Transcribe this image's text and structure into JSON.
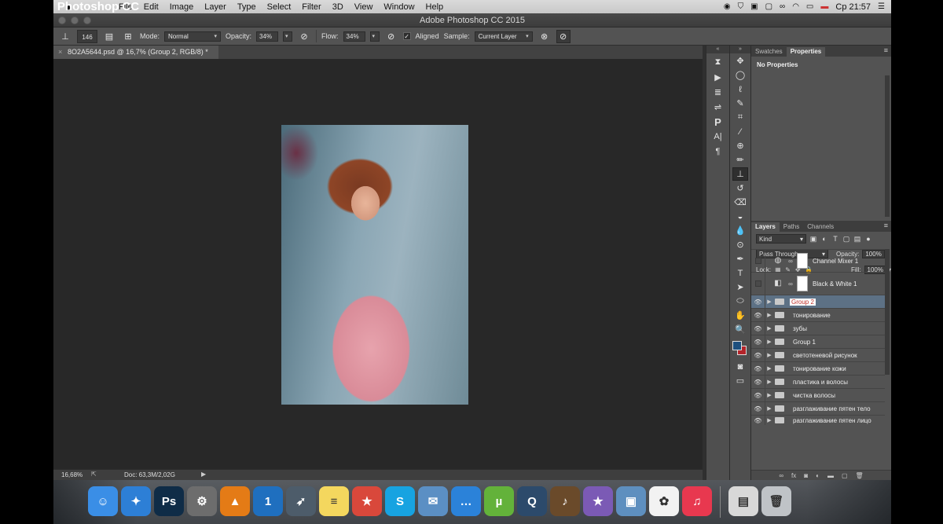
{
  "menubar": {
    "apple": "",
    "items": [
      "Photoshop CC",
      "File",
      "Edit",
      "Image",
      "Layer",
      "Type",
      "Select",
      "Filter",
      "3D",
      "View",
      "Window",
      "Help"
    ],
    "flag": "▬",
    "time": "Ср 21:57"
  },
  "window": {
    "title": "Adobe Photoshop CC 2015"
  },
  "options": {
    "brush_size": "146",
    "mode_label": "Mode:",
    "mode_value": "Normal",
    "opacity_label": "Opacity:",
    "opacity_value": "34%",
    "flow_label": "Flow:",
    "flow_value": "34%",
    "aligned_label": "Aligned",
    "aligned_checked": "✓",
    "sample_label": "Sample:",
    "sample_value": "Current Layer"
  },
  "document": {
    "tab_title": "8O2A5644.psd @ 16,7% (Group 2, RGB/8) *",
    "close": "×",
    "zoom": "16,68%",
    "doc_info": "Doc: 63,3M/2,02G"
  },
  "properties": {
    "tabs": [
      "Swatches",
      "Properties"
    ],
    "active_tab": "Properties",
    "content": "No Properties"
  },
  "layers": {
    "tabs": [
      "Layers",
      "Paths",
      "Channels"
    ],
    "kind_label": "Kind",
    "blend_mode": "Pass Through",
    "opacity_label": "Opacity:",
    "opacity_value": "100%",
    "lock_label": "Lock:",
    "fill_label": "Fill:",
    "fill_value": "100%",
    "items": [
      {
        "name": "Channel Mixer 1",
        "type": "adjustment",
        "visible": false
      },
      {
        "name": "Black & White 1",
        "type": "adjustment",
        "visible": false
      },
      {
        "name": "Group 2",
        "type": "group",
        "visible": true,
        "selected": true
      },
      {
        "name": "тонирование",
        "type": "group",
        "visible": true
      },
      {
        "name": "зубы",
        "type": "group",
        "visible": true
      },
      {
        "name": "Group 1",
        "type": "group",
        "visible": true
      },
      {
        "name": "светотеневой рисунок",
        "type": "group",
        "visible": true
      },
      {
        "name": "тонирование кожи",
        "type": "group",
        "visible": true
      },
      {
        "name": "пластика и волосы",
        "type": "group",
        "visible": true
      },
      {
        "name": "чистка волосы",
        "type": "group",
        "visible": true
      },
      {
        "name": "разглаживание пятен тело",
        "type": "group",
        "visible": true
      },
      {
        "name": "разглаживание пятен лицо",
        "type": "group",
        "visible": true
      }
    ]
  },
  "colors": {
    "foreground": "#1d4f7e",
    "background": "#b3242a",
    "selection": "#5d7185"
  },
  "dock": {
    "apps": [
      {
        "name": "Finder",
        "glyph": "☺",
        "color": "#3a8ee6"
      },
      {
        "name": "Safari",
        "glyph": "✦",
        "color": "#2d7fd6"
      },
      {
        "name": "Photoshop",
        "glyph": "Ps",
        "color": "#0f2c47"
      },
      {
        "name": "System Preferences",
        "glyph": "⚙",
        "color": "#6d6d6d"
      },
      {
        "name": "VLC",
        "glyph": "▲",
        "color": "#e47b16"
      },
      {
        "name": "1Password",
        "glyph": "1",
        "color": "#1f6fbf"
      },
      {
        "name": "Launchpad",
        "glyph": "➶",
        "color": "#4d5c6a"
      },
      {
        "name": "Notes",
        "glyph": "≡",
        "color": "#f4d75e"
      },
      {
        "name": "Wunderlist",
        "glyph": "★",
        "color": "#d9483b"
      },
      {
        "name": "Skype",
        "glyph": "S",
        "color": "#17a3e1"
      },
      {
        "name": "Preview",
        "glyph": "✉",
        "color": "#5b8fc4"
      },
      {
        "name": "Messages",
        "glyph": "…",
        "color": "#2b82d9"
      },
      {
        "name": "uTorrent",
        "glyph": "µ",
        "color": "#63b23a"
      },
      {
        "name": "QuickTime",
        "glyph": "Q",
        "color": "#2c4a6b"
      },
      {
        "name": "GarageBand",
        "glyph": "♪",
        "color": "#6a4a2a"
      },
      {
        "name": "iMovie",
        "glyph": "★",
        "color": "#7b5ab5"
      },
      {
        "name": "iPhoto",
        "glyph": "▣",
        "color": "#5e8fbf"
      },
      {
        "name": "Photos",
        "glyph": "✿",
        "color": "#f2f2f2"
      },
      {
        "name": "iTunes",
        "glyph": "♫",
        "color": "#e8384f"
      },
      {
        "name": "Screenshot",
        "glyph": "▤",
        "color": "#d8d8d8"
      },
      {
        "name": "Trash",
        "glyph": "🗑",
        "color": "#bfc3c7"
      }
    ]
  }
}
